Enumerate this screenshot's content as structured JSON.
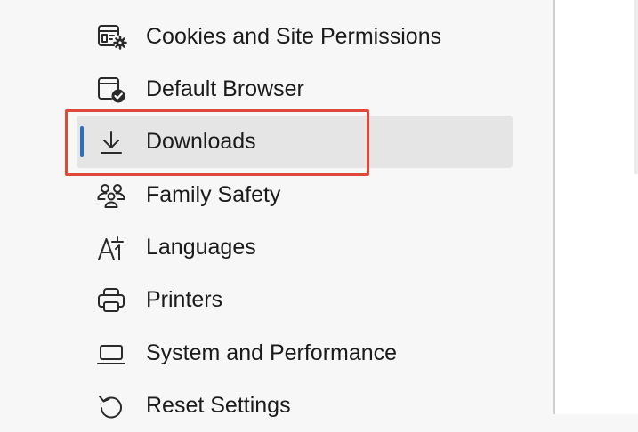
{
  "sidebar": {
    "items": [
      {
        "icon": "cookies-icon",
        "label": "Cookies and Site Permissions"
      },
      {
        "icon": "default-browser-icon",
        "label": "Default Browser"
      },
      {
        "icon": "download-icon",
        "label": "Downloads",
        "selected": true
      },
      {
        "icon": "family-icon",
        "label": "Family Safety"
      },
      {
        "icon": "languages-icon",
        "label": "Languages"
      },
      {
        "icon": "printer-icon",
        "label": "Printers"
      },
      {
        "icon": "laptop-icon",
        "label": "System and Performance"
      },
      {
        "icon": "reset-icon",
        "label": "Reset Settings"
      }
    ]
  },
  "colors": {
    "selected_background": "#e5e5e5",
    "active_indicator": "#2f6dc1",
    "highlight_outline": "#e0483a",
    "text": "#1b1b1b"
  }
}
